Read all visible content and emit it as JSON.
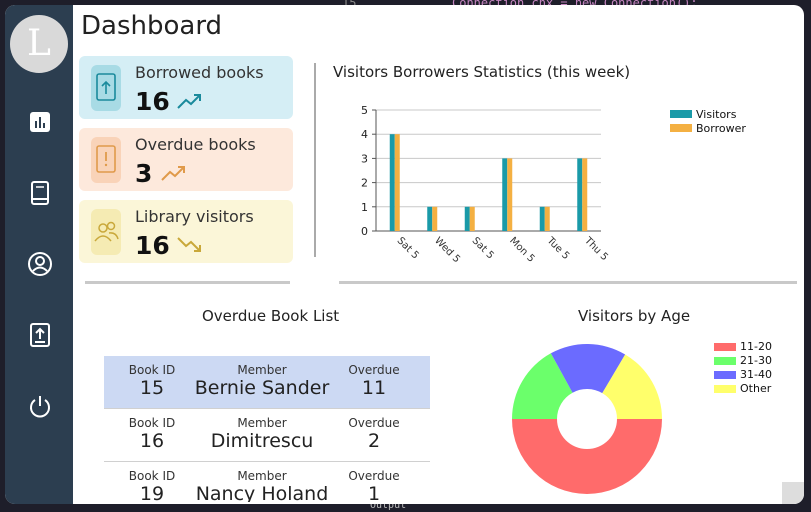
{
  "background_code": {
    "line_number": "15",
    "code": "Connection cnx = new Connection();",
    "output_label": "Output"
  },
  "sidebar": {
    "logo_letter": "L",
    "items": [
      {
        "name": "dashboard",
        "icon": "bar-chart-icon"
      },
      {
        "name": "books",
        "icon": "book-icon"
      },
      {
        "name": "members",
        "icon": "user-circle-icon"
      },
      {
        "name": "borrow",
        "icon": "upload-icon"
      },
      {
        "name": "logout",
        "icon": "power-icon"
      }
    ]
  },
  "header": {
    "title": "Dashboard"
  },
  "cards": [
    {
      "label": "Borrowed books",
      "value": "16",
      "trend": "up",
      "icon": "upload-file-icon",
      "bg": "#d5eef5",
      "accent": "#1a8a9c"
    },
    {
      "label": "Overdue books",
      "value": "3",
      "trend": "up",
      "icon": "alert-file-icon",
      "bg": "#fde9dc",
      "accent": "#e09a4a"
    },
    {
      "label": "Library visitors",
      "value": "16",
      "trend": "down",
      "icon": "users-icon",
      "bg": "#fbf6d8",
      "accent": "#c9a83a"
    }
  ],
  "bar_chart_title": "Visitors  Borrowers Statistics (this week)",
  "pie_chart_title": "Visitors by Age",
  "overdue_list": {
    "title": "Overdue Book List",
    "headers": {
      "book_id": "Book ID",
      "member": "Member",
      "overdue": "Overdue"
    },
    "rows": [
      {
        "book_id": "15",
        "member": "Bernie Sander",
        "overdue": "11"
      },
      {
        "book_id": "16",
        "member": "Dimitrescu",
        "overdue": "2"
      },
      {
        "book_id": "19",
        "member": "Nancy Holand",
        "overdue": "1"
      }
    ]
  },
  "chart_data": [
    {
      "type": "bar",
      "title": "Visitors  Borrowers Statistics (this week)",
      "categories": [
        "Sat 5",
        "Wed 5",
        "Sat 5",
        "Mon 5",
        "Tue 5",
        "Thu 5"
      ],
      "series": [
        {
          "name": "Visitors",
          "values": [
            4,
            1,
            1,
            3,
            1,
            3
          ],
          "color": "#1a9aa8"
        },
        {
          "name": "Borrower",
          "values": [
            4,
            1,
            1,
            3,
            1,
            3
          ],
          "color": "#f4b042"
        }
      ],
      "ylim": [
        0,
        5
      ],
      "yticks": [
        0,
        1,
        2,
        3,
        4,
        5
      ],
      "grid": true,
      "legend": "top-right"
    },
    {
      "type": "pie",
      "title": "Visitors by Age",
      "donut": true,
      "categories": [
        "11-20",
        "21-30",
        "31-40",
        "Other"
      ],
      "values": [
        50,
        17,
        16.5,
        16.5
      ],
      "colors": [
        "#ff6b6b",
        "#6bff6b",
        "#6b6bff",
        "#ffff6b"
      ],
      "legend": "top-right"
    }
  ]
}
